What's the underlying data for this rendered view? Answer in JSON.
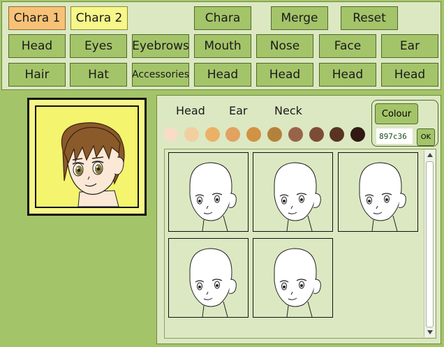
{
  "top": {
    "row1": {
      "chara1": "Chara 1",
      "chara2": "Chara 2",
      "chara": "Chara",
      "merge": "Merge",
      "reset": "Reset"
    },
    "row2": [
      "Head",
      "Eyes",
      "Eyebrows",
      "Mouth",
      "Nose",
      "Face",
      "Ear"
    ],
    "row3": [
      "Hair",
      "Hat",
      "Accessories",
      "Head",
      "Head",
      "Head",
      "Head"
    ]
  },
  "panel": {
    "tabs": [
      "Head",
      "Ear",
      "Neck"
    ],
    "swatches": [
      "#f7dcc6",
      "#f3cf9f",
      "#ebb166",
      "#e1a262",
      "#d09244",
      "#b3823a",
      "#986449",
      "#7d4c37",
      "#5a3322",
      "#301a12"
    ],
    "colour": {
      "button": "Colour",
      "value": "897c36",
      "ok": "OK"
    }
  },
  "thumbnail_count": 5,
  "colors": {
    "bg": "#a4c46a",
    "panel": "#dce8c2",
    "button": "#a4c46a",
    "chara1": "#f7c277",
    "chara2": "#f6f68a"
  }
}
